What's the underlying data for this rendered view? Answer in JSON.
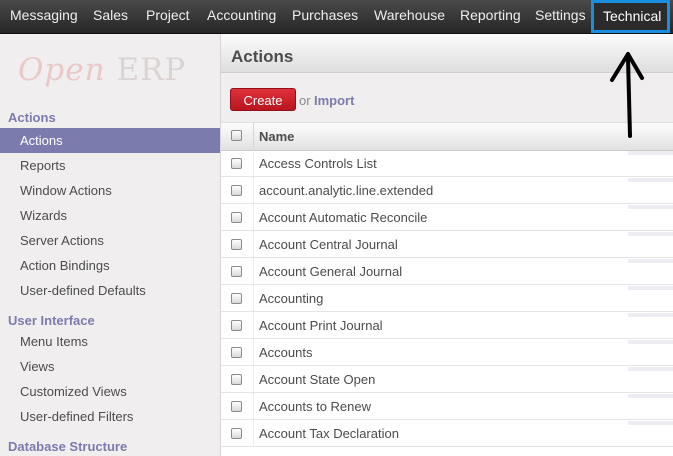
{
  "topbar": {
    "items": [
      "Messaging",
      "Sales",
      "Project",
      "Accounting",
      "Purchases",
      "Warehouse",
      "Reporting",
      "Settings"
    ],
    "active": "Technical"
  },
  "sidebar": {
    "logo_open": "Open",
    "logo_erp": "ERP",
    "sections": [
      {
        "title": "Actions",
        "items": [
          "Actions",
          "Reports",
          "Window Actions",
          "Wizards",
          "Server Actions",
          "Action Bindings",
          "User-defined Defaults"
        ]
      },
      {
        "title": "User Interface",
        "items": [
          "Menu Items",
          "Views",
          "Customized Views",
          "User-defined Filters"
        ]
      },
      {
        "title": "Database Structure",
        "items": []
      }
    ],
    "active_item": "Actions"
  },
  "main": {
    "title": "Actions",
    "create_label": "Create",
    "or_label": "or",
    "import_label": "Import",
    "column_name": "Name",
    "rows": [
      "Access Controls List",
      "account.analytic.line.extended",
      "Account Automatic Reconcile",
      "Account Central Journal",
      "Account General Journal",
      "Accounting",
      "Account Print Journal",
      "Accounts",
      "Account State Open",
      "Accounts to Renew",
      "Account Tax Declaration"
    ]
  },
  "colors": {
    "accent": "#7c7bad",
    "create": "#c1121c",
    "highlight_border": "#1a8ee0"
  }
}
